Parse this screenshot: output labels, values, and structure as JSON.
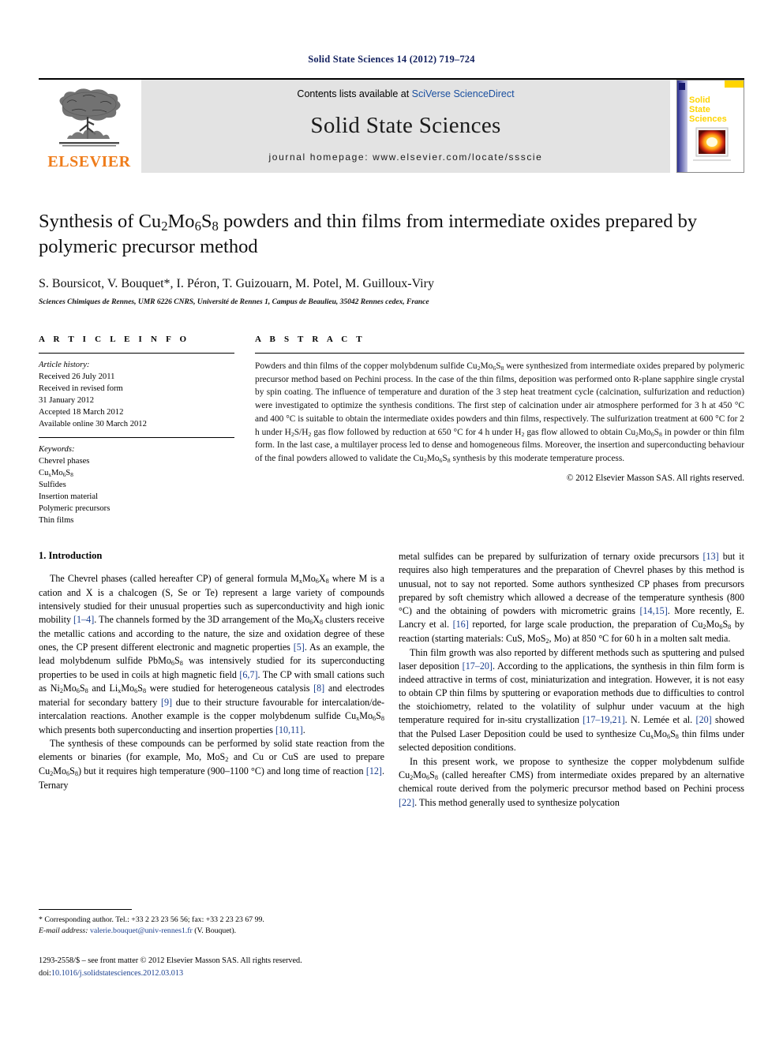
{
  "running_head": "Solid State Sciences 14 (2012) 719–724",
  "masthead": {
    "publisher_name": "ELSEVIER",
    "contents_prefix": "Contents lists available at ",
    "contents_link": "SciVerse ScienceDirect",
    "journal_title": "Solid State Sciences",
    "homepage": "journal homepage: www.elsevier.com/locate/ssscie",
    "cover": {
      "line1": "Solid",
      "line2": "State",
      "line3": "Sciences"
    }
  },
  "title_block": {
    "title_part1": "Synthesis of Cu",
    "title_sub1": "2",
    "title_part2": "Mo",
    "title_sub2": "6",
    "title_part3": "S",
    "title_sub3": "8",
    "title_part4": " powders and thin films from intermediate oxides prepared by polymeric precursor method",
    "authors": "S. Boursicot, V. Bouquet*, I. Péron, T. Guizouarn, M. Potel, M. Guilloux-Viry",
    "affiliation": "Sciences Chimiques de Rennes, UMR 6226 CNRS, Université de Rennes 1, Campus de Beaulieu, 35042 Rennes cedex, France"
  },
  "article_info": {
    "heading": "A R T I C L E   I N F O",
    "history_label": "Article history:",
    "history": [
      "Received 26 July 2011",
      "Received in revised form",
      "31 January 2012",
      "Accepted 18 March 2012",
      "Available online 30 March 2012"
    ],
    "keywords_label": "Keywords:",
    "keywords": [
      "Chevrel phases",
      "CuxMo6S8",
      "Sulfides",
      "Insertion material",
      "Polymeric precursors",
      "Thin films"
    ]
  },
  "abstract": {
    "heading": "A B S T R A C T",
    "text": "Powders and thin films of the copper molybdenum sulfide Cu2Mo6S8 were synthesized from intermediate oxides prepared by polymeric precursor method based on Pechini process. In the case of the thin films, deposition was performed onto R-plane sapphire single crystal by spin coating. The influence of temperature and duration of the 3 step heat treatment cycle (calcination, sulfurization and reduction) were investigated to optimize the synthesis conditions. The first step of calcination under air atmosphere performed for 3 h at 450 °C and 400 °C is suitable to obtain the intermediate oxides powders and thin films, respectively. The sulfurization treatment at 600 °C for 2 h under H2S/H2 gas flow followed by reduction at 650 °C for 4 h under H2 gas flow allowed to obtain Cu2Mo6S8 in powder or thin film form. In the last case, a multilayer process led to dense and homogeneous films. Moreover, the insertion and superconducting behaviour of the final powders allowed to validate the Cu2Mo6S8 synthesis by this moderate temperature process.",
    "copyright": "© 2012 Elsevier Masson SAS. All rights reserved."
  },
  "body": {
    "section_number_title": "1.  Introduction",
    "left_paragraphs": [
      "The Chevrel phases (called hereafter CP) of general formula MxMo6X8 where M is a cation and X is a chalcogen (S, Se or Te) represent a large variety of compounds intensively studied for their unusual properties such as superconductivity and high ionic mobility [1–4]. The channels formed by the 3D arrangement of the Mo6X8 clusters receive the metallic cations and according to the nature, the size and oxidation degree of these ones, the CP present different electronic and magnetic properties [5]. As an example, the lead molybdenum sulfide PbMo6S8 was intensively studied for its superconducting properties to be used in coils at high magnetic field [6,7]. The CP with small cations such as Ni2Mo6S8 and LixMo6S8 were studied for heterogeneous catalysis [8] and electrodes material for secondary battery [9] due to their structure favourable for intercalation/de-intercalation reactions. Another example is the copper molybdenum sulfide CuxMo6S8 which presents both superconducting and insertion properties [10,11].",
      "The synthesis of these compounds can be performed by solid state reaction from the elements or binaries (for example, Mo, MoS2 and Cu or CuS are used to prepare Cu2Mo6S8) but it requires high temperature (900–1100 °C) and long time of reaction [12]. Ternary"
    ],
    "right_paragraphs": [
      "metal sulfides can be prepared by sulfurization of ternary oxide precursors [13] but it requires also high temperatures and the preparation of Chevrel phases by this method is unusual, not to say not reported. Some authors synthesized CP phases from precursors prepared by soft chemistry which allowed a decrease of the temperature synthesis (800 °C) and the obtaining of powders with micrometric grains [14,15]. More recently, E. Lancry et al. [16] reported, for large scale production, the preparation of Cu2Mo6S8 by reaction (starting materials: CuS, MoS2, Mo) at 850 °C for 60 h in a molten salt media.",
      "Thin film growth was also reported by different methods such as sputtering and pulsed laser deposition [17–20]. According to the applications, the synthesis in thin film form is indeed attractive in terms of cost, miniaturization and integration. However, it is not easy to obtain CP thin films by sputtering or evaporation methods due to difficulties to control the stoichiometry, related to the volatility of sulphur under vacuum at the high temperature required for in-situ crystallization [17–19,21]. N. Lemée et al. [20] showed that the Pulsed Laser Deposition could be used to synthesize CuxMo6S8 thin films under selected deposition conditions.",
      "In this present work, we propose to synthesize the copper molybdenum sulfide Cu2Mo6S8 (called hereafter CMS) from intermediate oxides prepared by an alternative chemical route derived from the polymeric precursor method based on Pechini process [22]. This method generally used to synthesize polycation"
    ]
  },
  "footnote": {
    "marker": "*",
    "text": " Corresponding author. Tel.: +33 2 23 23 56 56; fax: +33 2 23 23 67 99.",
    "email_label": "E-mail address:",
    "email": "valerie.bouquet@univ-rennes1.fr",
    "email_suffix": " (V. Bouquet)."
  },
  "footer": {
    "front_matter": "1293-2558/$ – see front matter © 2012 Elsevier Masson SAS. All rights reserved.",
    "doi_label": "doi:",
    "doi": "10.1016/j.solidstatesciences.2012.03.013"
  },
  "colors": {
    "running_head": "#12205e",
    "link_blue": "#1a3f8f",
    "elsevier_orange": "#ef7c1a",
    "banner_grey": "#e3e3e3"
  }
}
